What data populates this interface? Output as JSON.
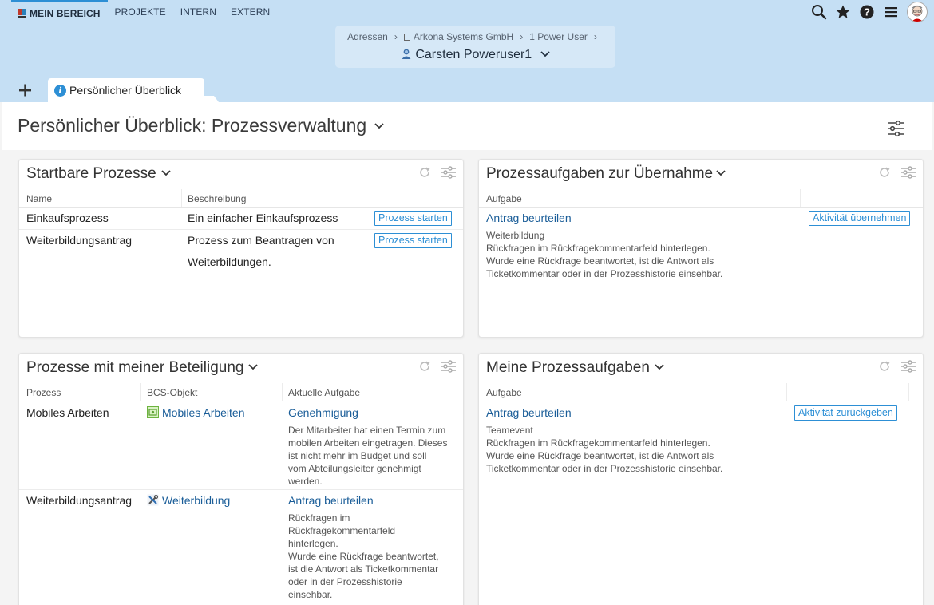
{
  "topnav": {
    "items": [
      "MEIN BEREICH",
      "PROJEKTE",
      "INTERN",
      "EXTERN"
    ]
  },
  "breadcrumb": {
    "items": [
      "Adressen",
      "Arkona Systems GmbH",
      "1 Power User"
    ],
    "person": "Carsten Poweruser1"
  },
  "tabs": {
    "active_label": "Persönlicher Überblick"
  },
  "page": {
    "title": "Persönlicher Überblick: Prozessverwaltung"
  },
  "startbare": {
    "title": "Startbare Prozesse",
    "columns": [
      "Name",
      "Beschreibung"
    ],
    "rows": [
      {
        "name": "Einkaufsprozess",
        "description": "Ein einfacher Einkaufsprozess",
        "button": "Prozess starten"
      },
      {
        "name": "Weiterbildungsantrag",
        "description_line1": "Prozess zum Beantragen von",
        "description_line2": "Weiterbildungen.",
        "button": "Prozess starten"
      }
    ]
  },
  "uebernahme": {
    "title": "Prozessaufgaben zur Übernahme",
    "columns": [
      "Aufgabe"
    ],
    "task_link": "Antrag beurteilen",
    "button": "Aktivität übernehmen",
    "context": "Weiterbildung",
    "desc_lines": [
      "Rückfragen im Rückfragekommentarfeld hinterlegen.",
      "Wurde eine Rückfrage beantwortet, ist die Antwort als",
      "Ticketkommentar oder in der Prozesshistorie einsehbar."
    ]
  },
  "beteiligung": {
    "title": "Prozesse mit meiner Beteiligung",
    "columns": [
      "Prozess",
      "BCS-Objekt",
      "Aktuelle Aufgabe"
    ],
    "rows": [
      {
        "process": "Mobiles Arbeiten",
        "object": "Mobiles Arbeiten",
        "task": "Genehmigung",
        "desc_lines": [
          "Der Mitarbeiter hat einen Termin zum",
          "mobilen Arbeiten eingetragen. Dieses",
          "ist nicht mehr im Budget und soll",
          "vom Abteilungsleiter genehmigt",
          "werden."
        ]
      },
      {
        "process": "Weiterbildungsantrag",
        "object": "Weiterbildung",
        "task": "Antrag beurteilen",
        "desc_lines": [
          "Rückfragen im",
          "Rückfragekommentarfeld",
          "hinterlegen.",
          "Wurde eine Rückfrage beantwortet,",
          "ist die Antwort als Ticketkommentar",
          "oder in der Prozesshistorie",
          "einsehbar."
        ]
      }
    ]
  },
  "meine": {
    "title": "Meine Prozessaufgaben",
    "columns": [
      "Aufgabe"
    ],
    "task_link": "Antrag beurteilen",
    "button": "Aktivität zurückgeben",
    "context": "Teamevent",
    "desc_lines": [
      "Rückfragen im Rückfragekommentarfeld hinterlegen.",
      "Wurde eine Rückfrage beantwortet, ist die Antwort als",
      "Ticketkommentar oder in der Prozesshistorie einsehbar."
    ]
  },
  "icons": {
    "search": "search-icon",
    "favorite": "star-icon",
    "help": "help-icon",
    "menu": "menu-icon",
    "refresh": "refresh-icon",
    "settings": "sliders-icon"
  },
  "colors": {
    "header_bg": "#c5dff4",
    "accent": "#2d8fd5",
    "link": "#1a5d98"
  }
}
